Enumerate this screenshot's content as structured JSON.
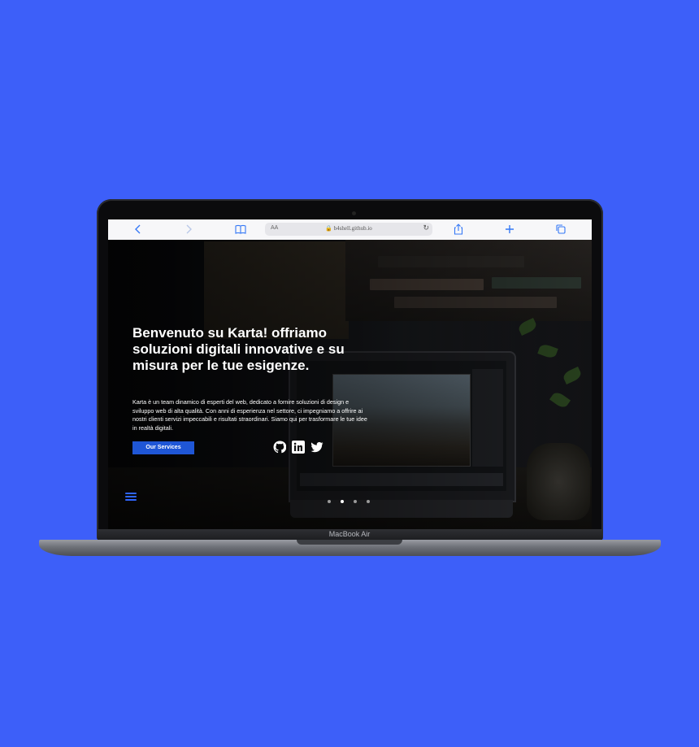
{
  "browser": {
    "reader_label": "AA",
    "url": "b4shell.github.io"
  },
  "hero": {
    "headline": "Benvenuto su Karta! offriamo soluzioni digitali innovative e su misura per le tue esigenze.",
    "description": "Karta è un team dinamico di esperti del web, dedicato a fornire soluzioni di design e sviluppo web di alta qualità. Con anni di esperienza nel settore, ci impegniamo a offrire ai nostri clienti servizi impeccabili e risultati straordinari. Siamo qui per trasformare le tue idee in realtà digitali.",
    "cta_label": "Our Services"
  },
  "social": [
    "github-icon",
    "linkedin-icon",
    "twitter-icon"
  ],
  "carousel": {
    "slides": 4,
    "active": 2
  },
  "device": {
    "model": "MacBook Air"
  },
  "colors": {
    "background": "#3d5ff9",
    "accent": "#1f56d6",
    "menu": "#2f66ff"
  }
}
